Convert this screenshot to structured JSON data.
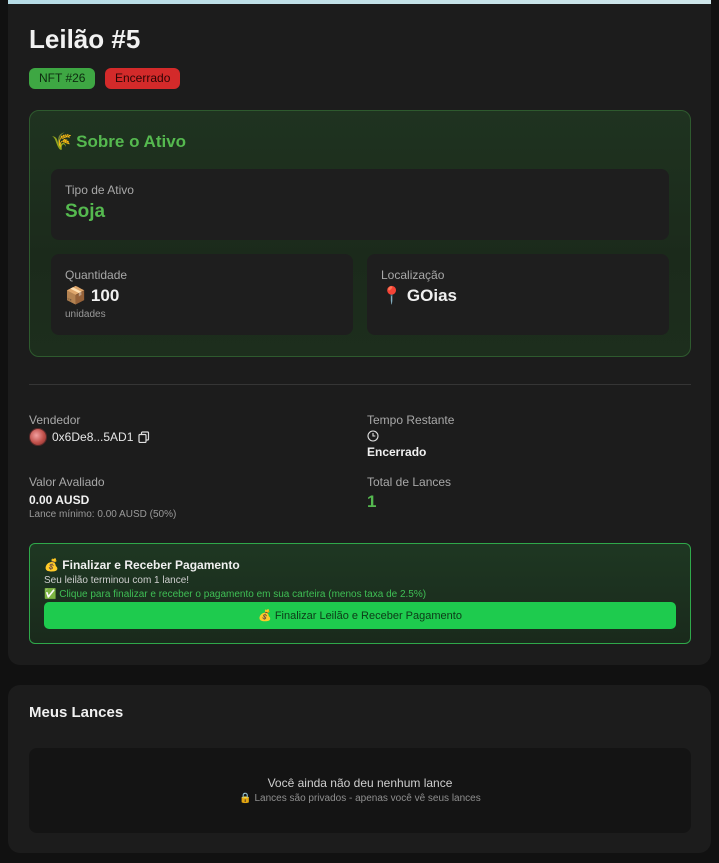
{
  "auction": {
    "title": "Leilão #5",
    "nft_badge": "NFT #26",
    "status_badge": "Encerrado"
  },
  "asset": {
    "heading_icon": "🌾",
    "heading": "Sobre o Ativo",
    "type_label": "Tipo de Ativo",
    "type_value": "Soja",
    "quantity_label": "Quantidade",
    "quantity_icon": "📦",
    "quantity_value": "100",
    "quantity_unit": "unidades",
    "location_label": "Localização",
    "location_icon": "📍",
    "location_value": "GOias"
  },
  "details": {
    "seller_label": "Vendedor",
    "seller_address": "0x6De8...5AD1",
    "time_label": "Tempo Restante",
    "time_value": "Encerrado",
    "valuation_label": "Valor Avaliado",
    "valuation_value": "0.00 AUSD",
    "min_bid": "Lance mínimo: 0.00 AUSD (50%)",
    "total_bids_label": "Total de Lances",
    "total_bids_value": "1"
  },
  "payment": {
    "icon": "💰",
    "title": "Finalizar e Receber Pagamento",
    "subtitle": "Seu leilão terminou com 1 lance!",
    "hint_icon": "✅",
    "hint": "Clique para finalizar e receber o pagamento em sua carteira (menos taxa de 2.5%)",
    "button_icon": "💰",
    "button_label": "Finalizar Leilão e Receber Pagamento"
  },
  "my_bids": {
    "title": "Meus Lances",
    "empty_message": "Você ainda não deu nenhum lance",
    "privacy_icon": "🔒",
    "privacy_note": "Lances são privados - apenas você vê seus lances"
  },
  "colors": {
    "accent_green": "#55b94f",
    "button_green": "#1ecb4e",
    "danger_red": "#d32a2a",
    "background": "#111111",
    "card": "#1c1c1c"
  }
}
